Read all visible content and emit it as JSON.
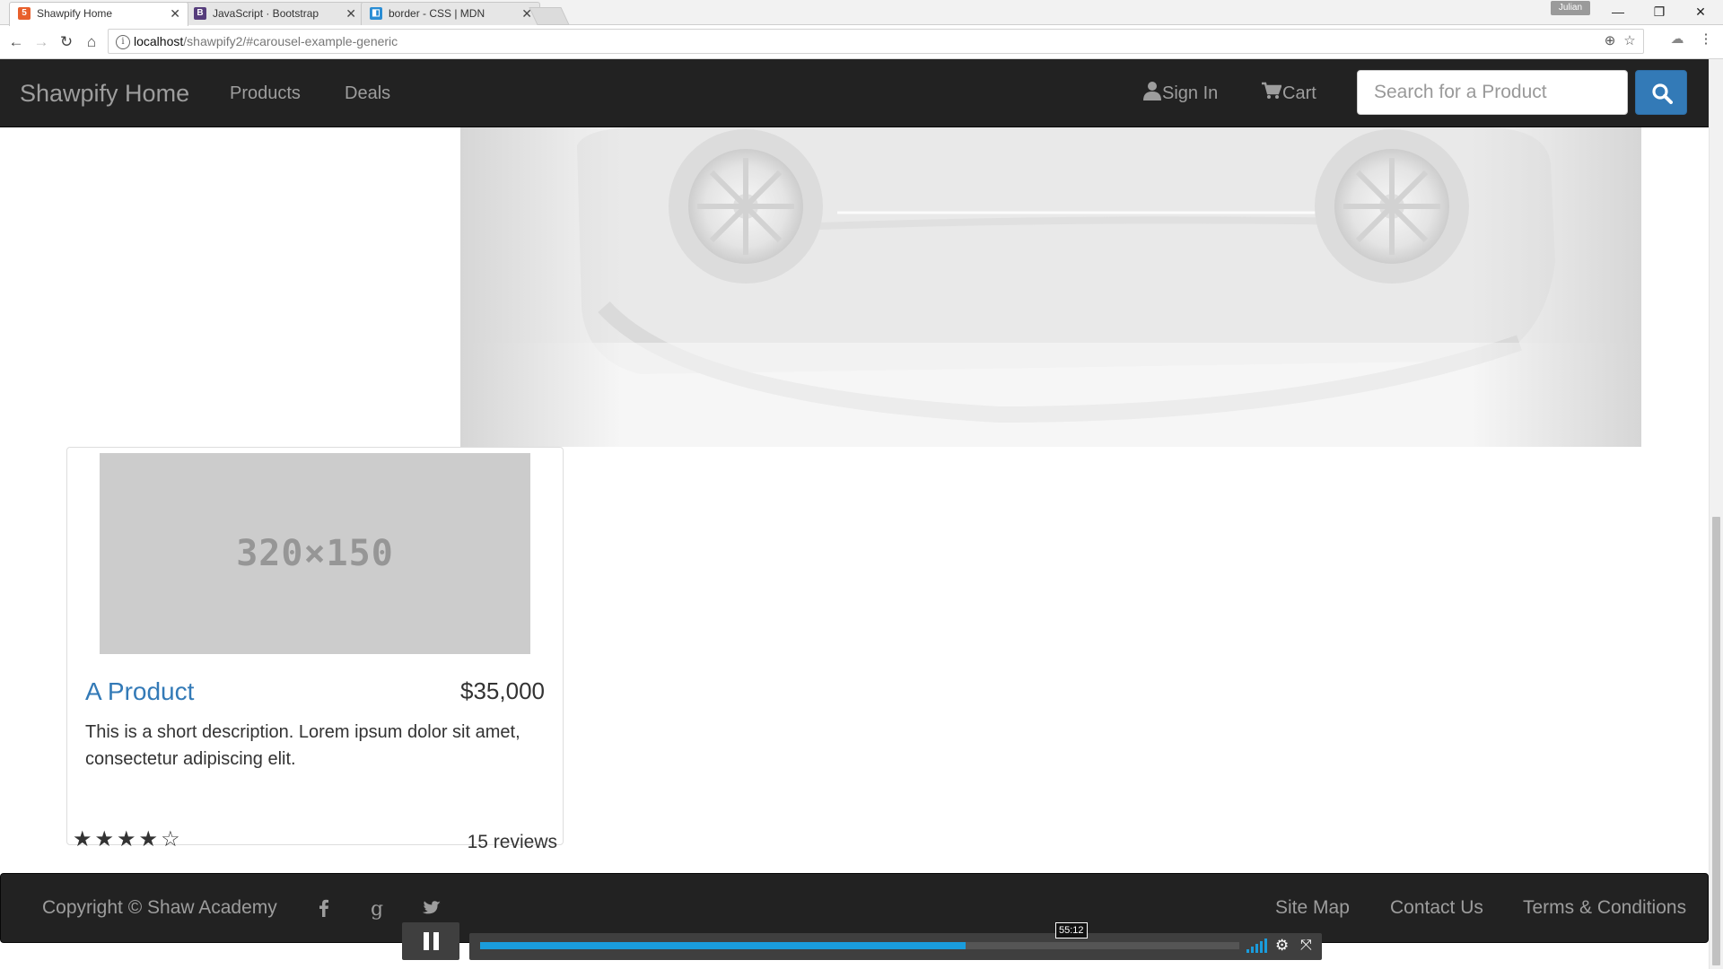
{
  "browser": {
    "tabs": [
      {
        "title": "Shawpify Home",
        "favicon": "html-badge-icon",
        "color": "#e8602c",
        "active": true
      },
      {
        "title": "JavaScript · Bootstrap",
        "favicon": "bootstrap-b-icon",
        "color": "#563d7c",
        "active": false
      },
      {
        "title": "border - CSS | MDN",
        "favicon": "mdn-icon",
        "color": "#2a8dd4",
        "active": false
      }
    ],
    "user_label": "Julian",
    "url_host": "localhost",
    "url_path": "/shawpify2/#carousel-example-generic"
  },
  "nav": {
    "brand": "Shawpify Home",
    "links": [
      "Products",
      "Deals"
    ],
    "signin": "Sign In",
    "cart": "Cart",
    "search_placeholder": "Search for a Product",
    "search_value": ""
  },
  "product": {
    "placeholder_label": "320×150",
    "name": "A Product",
    "price": "$35,000",
    "description": "This is a short description. Lorem ipsum dolor sit amet, consectetur adipiscing elit.",
    "rating": 4,
    "rating_max": 5,
    "reviews": "15 reviews"
  },
  "footer": {
    "copyright": "Copyright © Shaw Academy",
    "social": [
      "facebook-icon",
      "google-plus-icon",
      "twitter-icon"
    ],
    "links": [
      "Site Map",
      "Contact Us",
      "Terms & Conditions"
    ]
  },
  "video": {
    "time_tooltip": "55:12",
    "progress": 0.64,
    "accent": "#1a9cdc"
  },
  "colors": {
    "navbar_bg": "#222222",
    "link": "#337ab7",
    "nav_text": "#9d9d9d"
  }
}
